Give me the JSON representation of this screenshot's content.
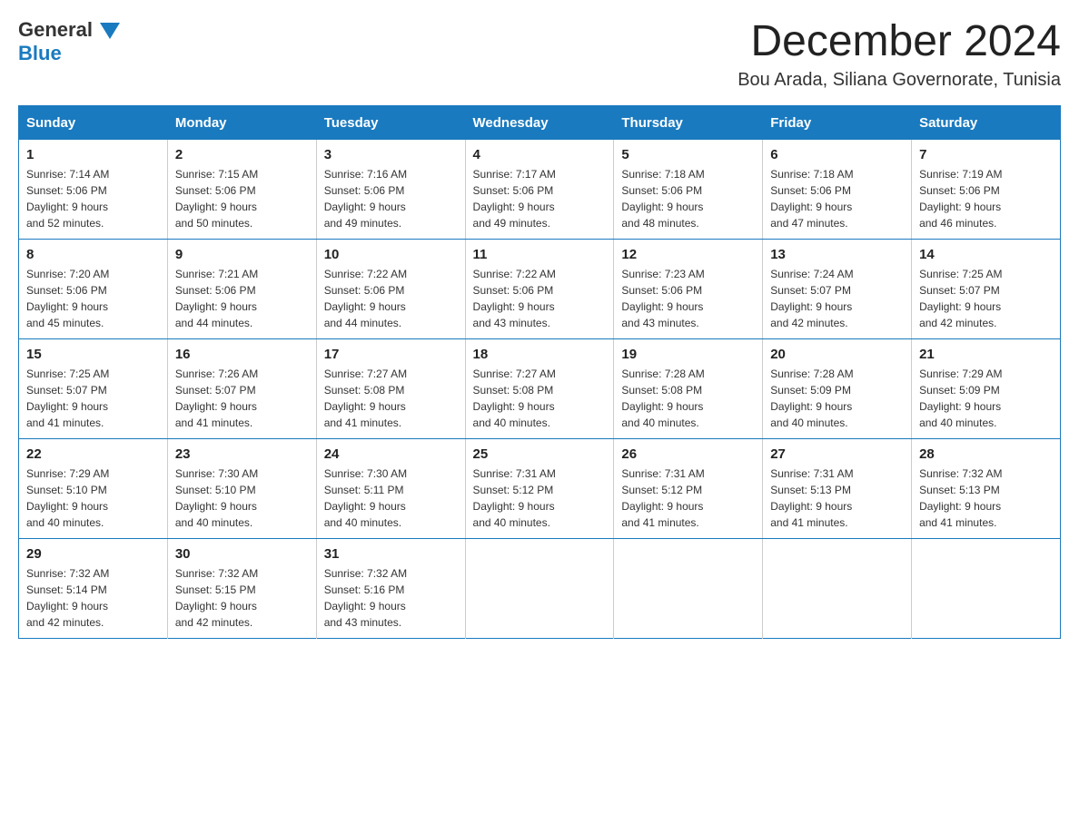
{
  "header": {
    "logo": {
      "general": "General",
      "blue": "Blue"
    },
    "title": "December 2024",
    "location": "Bou Arada, Siliana Governorate, Tunisia"
  },
  "calendar": {
    "days_of_week": [
      "Sunday",
      "Monday",
      "Tuesday",
      "Wednesday",
      "Thursday",
      "Friday",
      "Saturday"
    ],
    "weeks": [
      [
        {
          "day": "1",
          "sunrise": "7:14 AM",
          "sunset": "5:06 PM",
          "daylight": "9 hours and 52 minutes."
        },
        {
          "day": "2",
          "sunrise": "7:15 AM",
          "sunset": "5:06 PM",
          "daylight": "9 hours and 50 minutes."
        },
        {
          "day": "3",
          "sunrise": "7:16 AM",
          "sunset": "5:06 PM",
          "daylight": "9 hours and 49 minutes."
        },
        {
          "day": "4",
          "sunrise": "7:17 AM",
          "sunset": "5:06 PM",
          "daylight": "9 hours and 49 minutes."
        },
        {
          "day": "5",
          "sunrise": "7:18 AM",
          "sunset": "5:06 PM",
          "daylight": "9 hours and 48 minutes."
        },
        {
          "day": "6",
          "sunrise": "7:18 AM",
          "sunset": "5:06 PM",
          "daylight": "9 hours and 47 minutes."
        },
        {
          "day": "7",
          "sunrise": "7:19 AM",
          "sunset": "5:06 PM",
          "daylight": "9 hours and 46 minutes."
        }
      ],
      [
        {
          "day": "8",
          "sunrise": "7:20 AM",
          "sunset": "5:06 PM",
          "daylight": "9 hours and 45 minutes."
        },
        {
          "day": "9",
          "sunrise": "7:21 AM",
          "sunset": "5:06 PM",
          "daylight": "9 hours and 44 minutes."
        },
        {
          "day": "10",
          "sunrise": "7:22 AM",
          "sunset": "5:06 PM",
          "daylight": "9 hours and 44 minutes."
        },
        {
          "day": "11",
          "sunrise": "7:22 AM",
          "sunset": "5:06 PM",
          "daylight": "9 hours and 43 minutes."
        },
        {
          "day": "12",
          "sunrise": "7:23 AM",
          "sunset": "5:06 PM",
          "daylight": "9 hours and 43 minutes."
        },
        {
          "day": "13",
          "sunrise": "7:24 AM",
          "sunset": "5:07 PM",
          "daylight": "9 hours and 42 minutes."
        },
        {
          "day": "14",
          "sunrise": "7:25 AM",
          "sunset": "5:07 PM",
          "daylight": "9 hours and 42 minutes."
        }
      ],
      [
        {
          "day": "15",
          "sunrise": "7:25 AM",
          "sunset": "5:07 PM",
          "daylight": "9 hours and 41 minutes."
        },
        {
          "day": "16",
          "sunrise": "7:26 AM",
          "sunset": "5:07 PM",
          "daylight": "9 hours and 41 minutes."
        },
        {
          "day": "17",
          "sunrise": "7:27 AM",
          "sunset": "5:08 PM",
          "daylight": "9 hours and 41 minutes."
        },
        {
          "day": "18",
          "sunrise": "7:27 AM",
          "sunset": "5:08 PM",
          "daylight": "9 hours and 40 minutes."
        },
        {
          "day": "19",
          "sunrise": "7:28 AM",
          "sunset": "5:08 PM",
          "daylight": "9 hours and 40 minutes."
        },
        {
          "day": "20",
          "sunrise": "7:28 AM",
          "sunset": "5:09 PM",
          "daylight": "9 hours and 40 minutes."
        },
        {
          "day": "21",
          "sunrise": "7:29 AM",
          "sunset": "5:09 PM",
          "daylight": "9 hours and 40 minutes."
        }
      ],
      [
        {
          "day": "22",
          "sunrise": "7:29 AM",
          "sunset": "5:10 PM",
          "daylight": "9 hours and 40 minutes."
        },
        {
          "day": "23",
          "sunrise": "7:30 AM",
          "sunset": "5:10 PM",
          "daylight": "9 hours and 40 minutes."
        },
        {
          "day": "24",
          "sunrise": "7:30 AM",
          "sunset": "5:11 PM",
          "daylight": "9 hours and 40 minutes."
        },
        {
          "day": "25",
          "sunrise": "7:31 AM",
          "sunset": "5:12 PM",
          "daylight": "9 hours and 40 minutes."
        },
        {
          "day": "26",
          "sunrise": "7:31 AM",
          "sunset": "5:12 PM",
          "daylight": "9 hours and 41 minutes."
        },
        {
          "day": "27",
          "sunrise": "7:31 AM",
          "sunset": "5:13 PM",
          "daylight": "9 hours and 41 minutes."
        },
        {
          "day": "28",
          "sunrise": "7:32 AM",
          "sunset": "5:13 PM",
          "daylight": "9 hours and 41 minutes."
        }
      ],
      [
        {
          "day": "29",
          "sunrise": "7:32 AM",
          "sunset": "5:14 PM",
          "daylight": "9 hours and 42 minutes."
        },
        {
          "day": "30",
          "sunrise": "7:32 AM",
          "sunset": "5:15 PM",
          "daylight": "9 hours and 42 minutes."
        },
        {
          "day": "31",
          "sunrise": "7:32 AM",
          "sunset": "5:16 PM",
          "daylight": "9 hours and 43 minutes."
        },
        null,
        null,
        null,
        null
      ]
    ],
    "labels": {
      "sunrise": "Sunrise:",
      "sunset": "Sunset:",
      "daylight": "Daylight:"
    }
  }
}
